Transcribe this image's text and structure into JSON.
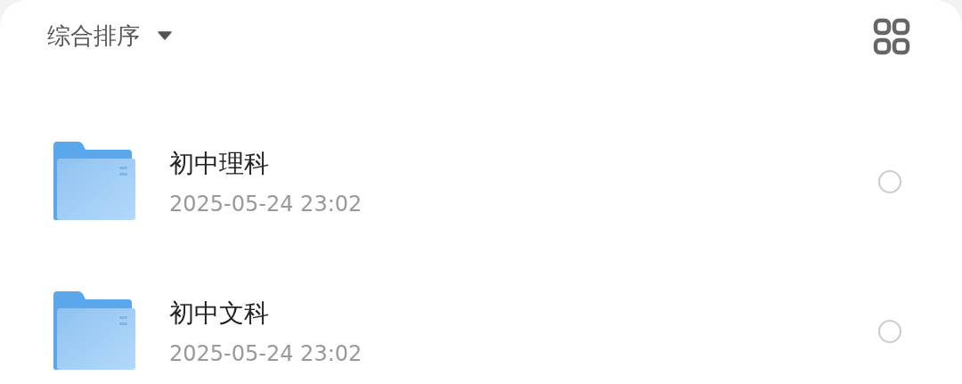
{
  "sort": {
    "label": "综合排序"
  },
  "folders": [
    {
      "name": "初中理科",
      "date": "2025-05-24 23:02",
      "selected": false
    },
    {
      "name": "初中文科",
      "date": "2025-05-24 23:02",
      "selected": false
    }
  ]
}
